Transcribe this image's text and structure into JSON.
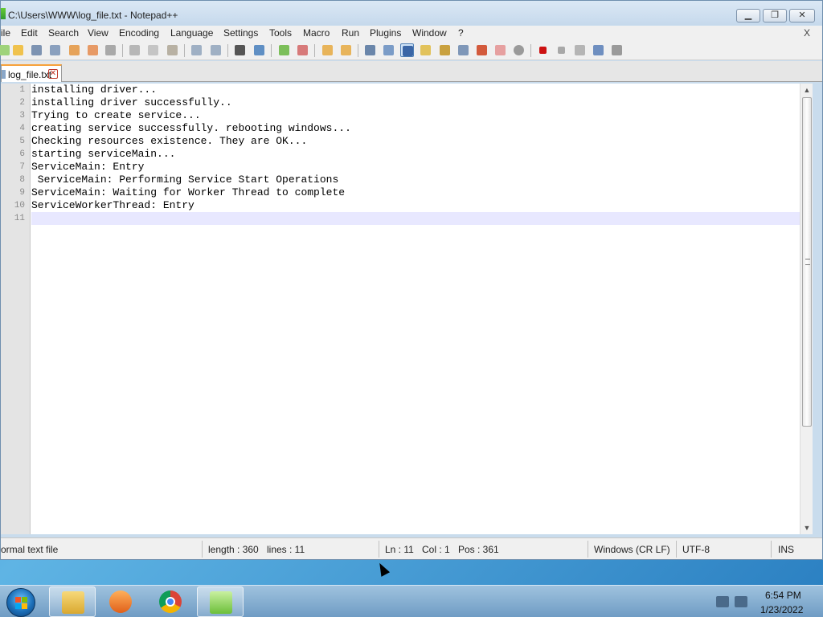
{
  "window": {
    "title": "C:\\Users\\WWW\\log_file.txt - Notepad++"
  },
  "menu": {
    "items": [
      "ile",
      "Edit",
      "Search",
      "View",
      "Encoding",
      "Language",
      "Settings",
      "Tools",
      "Macro",
      "Run",
      "Plugins",
      "Window",
      "?"
    ],
    "close": "X"
  },
  "toolbar": {
    "icons": [
      "new-file-icon",
      "open-file-icon",
      "save-icon",
      "save-all-icon",
      "close-file-icon",
      "close-all-icon",
      "print-icon",
      "cut-icon",
      "copy-icon",
      "paste-icon",
      "undo-icon",
      "redo-icon",
      "find-icon",
      "replace-icon",
      "zoom-in-icon",
      "zoom-out-icon",
      "sync-vertical-icon",
      "sync-horizontal-icon",
      "word-wrap-icon",
      "show-all-chars-icon",
      "indent-guide-icon",
      "language-udl-icon",
      "document-map-icon",
      "function-list-icon",
      "folder-as-workspace-icon",
      "monitoring-icon",
      "record-macro-icon",
      "stop-record-icon",
      "play-macro-icon",
      "run-macro-multiple-icon",
      "save-macro-icon"
    ],
    "colors": {
      "accent": "#4f7fb5",
      "record": "#cc1111"
    }
  },
  "tabs": [
    {
      "label": "log_file.txt",
      "close": "✕"
    }
  ],
  "editor": {
    "lines": [
      "installing driver...",
      "installing driver successfully..",
      "Trying to create service...",
      "creating service successfully. rebooting windows...",
      "Checking resources existence. They are OK...",
      "starting serviceMain...",
      "ServiceMain: Entry",
      " ServiceMain: Performing Service Start Operations",
      "ServiceMain: Waiting for Worker Thread to complete",
      "ServiceWorkerThread: Entry",
      ""
    ],
    "line_numbers": [
      "1",
      "2",
      "3",
      "4",
      "5",
      "6",
      "7",
      "8",
      "9",
      "10",
      "11"
    ],
    "current_line": 11
  },
  "status": {
    "file_type": "ormal text file",
    "length": "length : 360",
    "lines": "lines : 11",
    "ln": "Ln : 11",
    "col": "Col : 1",
    "pos": "Pos : 361",
    "eol": "Windows (CR LF)",
    "encoding": "UTF-8",
    "mode": "INS"
  },
  "taskbar": {
    "apps": [
      "windows-explorer-icon",
      "media-player-icon",
      "chrome-icon",
      "notepad-plus-plus-icon"
    ],
    "clock": {
      "time": "6:54 PM",
      "date": "1/23/2022"
    }
  }
}
